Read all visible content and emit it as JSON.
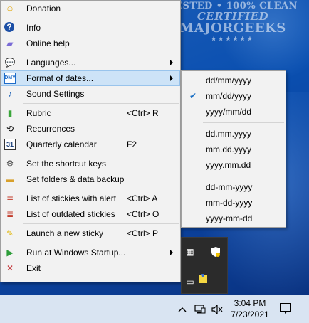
{
  "watermark": {
    "line1": "TESTED • 100% CLEAN",
    "line2": "CERTIFIED",
    "line3": "MAJORGEEKS",
    "stars": "★★★★★★"
  },
  "menu": {
    "items": [
      {
        "label": "Donation",
        "icon": "smiley-icon",
        "glyph": "☺",
        "color": "#e0a400"
      },
      {
        "label": "Info",
        "icon": "help-icon",
        "glyph": "?",
        "color": "#1c4fa6"
      },
      {
        "label": "Online help",
        "icon": "book-icon",
        "glyph": "▰",
        "color": "#7a6bd6"
      },
      {
        "label": "Languages...",
        "icon": "speech-bubble-icon",
        "glyph": "💬",
        "color": "#6a8cc7"
      },
      {
        "label": "Format of dates...",
        "icon": "date-format-icon",
        "glyph": "DMY",
        "color": "#1e6cc9"
      },
      {
        "label": "Sound Settings",
        "icon": "music-note-icon",
        "glyph": "♪",
        "color": "#1a5fb4"
      },
      {
        "label": "Rubric",
        "shortcut": "<Ctrl> R",
        "icon": "green-book-icon",
        "glyph": "▮",
        "color": "#3aa63a"
      },
      {
        "label": "Recurrences",
        "icon": "repeat-icon",
        "glyph": "⟲",
        "color": "#000000"
      },
      {
        "label": "Quarterly calendar",
        "shortcut": "F2",
        "icon": "calendar-icon",
        "glyph": "31",
        "color": "#1a3f7a"
      },
      {
        "label": "Set the shortcut keys",
        "icon": "gear-icon",
        "glyph": "⚙",
        "color": "#555555"
      },
      {
        "label": "Set folders & data backup",
        "icon": "folder-icon",
        "glyph": "▬",
        "color": "#d8a02b"
      },
      {
        "label": "List of stickies with alert",
        "shortcut": "<Ctrl> A",
        "icon": "alert-list-icon",
        "glyph": "≣",
        "color": "#c23b2a"
      },
      {
        "label": "List of outdated stickies",
        "shortcut": "<Ctrl> O",
        "icon": "outdated-list-icon",
        "glyph": "≣",
        "color": "#c23b2a"
      },
      {
        "label": "Launch a new sticky",
        "shortcut": "<Ctrl> P",
        "icon": "new-sticky-icon",
        "glyph": "✎",
        "color": "#e0b400"
      },
      {
        "label": "Run at Windows Startup...",
        "icon": "play-icon",
        "glyph": "▶",
        "color": "#2e9e3a"
      },
      {
        "label": "Exit",
        "icon": "close-icon",
        "glyph": "✕",
        "color": "#c0282c"
      }
    ]
  },
  "submenu": {
    "items": [
      {
        "label": "dd/mm/yyyy",
        "checked": false
      },
      {
        "label": "mm/dd/yyyy",
        "checked": true
      },
      {
        "label": "yyyy/mm/dd",
        "checked": false
      },
      {
        "label": "dd.mm.yyyy",
        "checked": false
      },
      {
        "label": "mm.dd.yyyy",
        "checked": false
      },
      {
        "label": "yyyy.mm.dd",
        "checked": false
      },
      {
        "label": "dd-mm-yyyy",
        "checked": false
      },
      {
        "label": "mm-dd-yyyy",
        "checked": false
      },
      {
        "label": "yyyy-mm-dd",
        "checked": false
      }
    ],
    "check_glyph": "✔"
  },
  "taskbar": {
    "time": "3:04 PM",
    "date": "7/23/2021",
    "icons": {
      "chevron": "^",
      "network": "▭",
      "volume": "🔈×"
    }
  }
}
